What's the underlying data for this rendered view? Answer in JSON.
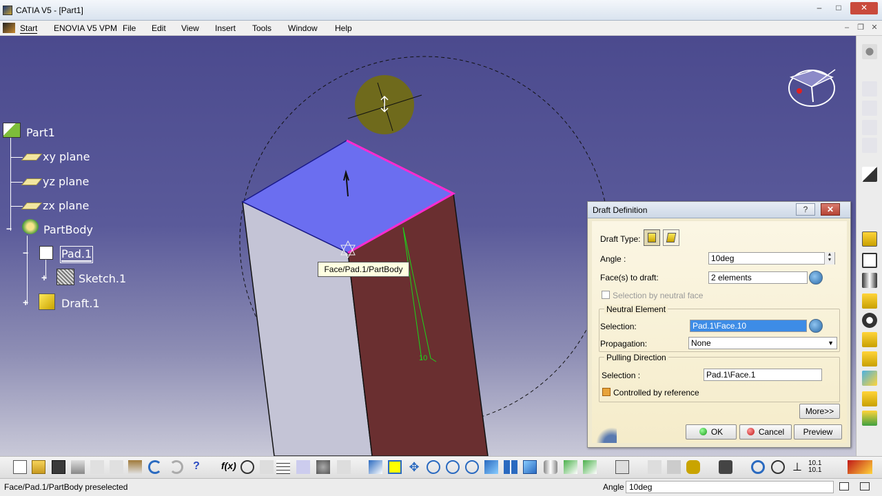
{
  "window": {
    "title": "CATIA V5 - [Part1]",
    "btn_min": "–",
    "btn_max": "□",
    "btn_close": "✕"
  },
  "menu": {
    "items": [
      "Start",
      "ENOVIA V5 VPM",
      "File",
      "Edit",
      "View",
      "Insert",
      "Tools",
      "Window",
      "Help"
    ],
    "mdi_min": "–",
    "mdi_restore": "❐",
    "mdi_close": "✕"
  },
  "tree": {
    "root": "Part1",
    "xy": "xy plane",
    "yz": "yz plane",
    "zx": "zx plane",
    "body": "PartBody",
    "pad": "Pad.1",
    "sketch": "Sketch.1",
    "draft": "Draft.1"
  },
  "tooltip": "Face/Pad.1/PartBody",
  "viewport": {
    "angle_annotation": "10"
  },
  "dialog": {
    "title": "Draft Definition",
    "help": "?",
    "close": "✕",
    "draft_type_label": "Draft Type:",
    "angle_label": "Angle :",
    "angle_value": "10deg",
    "faces_label": "Face(s) to draft:",
    "faces_value": "2 elements",
    "neutral_checkbox": "Selection by neutral face",
    "neutral_group": "Neutral Element",
    "neutral_selection_label": "Selection:",
    "neutral_selection_value": "Pad.1\\Face.10",
    "propagation_label": "Propagation:",
    "propagation_value": "None",
    "pulling_group": "Pulling Direction",
    "pulling_selection_label": "Selection :",
    "pulling_selection_value": "Pad.1\\Face.1",
    "controlled_label": "Controlled by reference",
    "more": "More>>",
    "ok": "OK",
    "cancel": "Cancel",
    "preview": "Preview"
  },
  "status": {
    "message": "Face/Pad.1/PartBody preselected",
    "angle_label": "Angle",
    "angle_value": "10deg"
  },
  "colors": {
    "viewport_top": "#4b4a8e",
    "face_top": "#6b6ef0",
    "face_right": "#6a2f30",
    "face_left": "#c4c4d6",
    "highlight_edge": "#ff2bd0",
    "dialog_bg": "#f0ead0"
  },
  "icons": {
    "right_toolbar": [
      "gear-icon",
      "select-arrow-icon",
      "pad-icon",
      "pocket-icon",
      "shaft-icon",
      "groove-icon",
      "hole-icon",
      "rib-icon",
      "slot-icon",
      "solid-icon",
      "stiffener-icon",
      "loft-icon"
    ],
    "bottom_toolbar": [
      "new-icon",
      "open-icon",
      "save-icon",
      "print-icon",
      "cut-icon",
      "copy-icon",
      "paste-icon",
      "undo-icon",
      "redo-icon",
      "whats-this-icon",
      "formula-icon",
      "comment-icon",
      "knowledge-icon",
      "table-icon",
      "catalog-icon",
      "analysis-icon",
      "measure-icon",
      "fly-icon",
      "fit-all-icon",
      "pan-icon",
      "rotate-icon",
      "zoom-in-icon",
      "zoom-out-icon",
      "normal-view-icon",
      "multi-view-icon",
      "iso-view-icon",
      "shading-icon",
      "edges-icon",
      "hide-show-icon",
      "swap-icon",
      "apply-material-icon",
      "camera-icon",
      "3d-compass-icon",
      "hand-icon",
      "compass-reset-icon",
      "catia-logo-icon"
    ]
  }
}
